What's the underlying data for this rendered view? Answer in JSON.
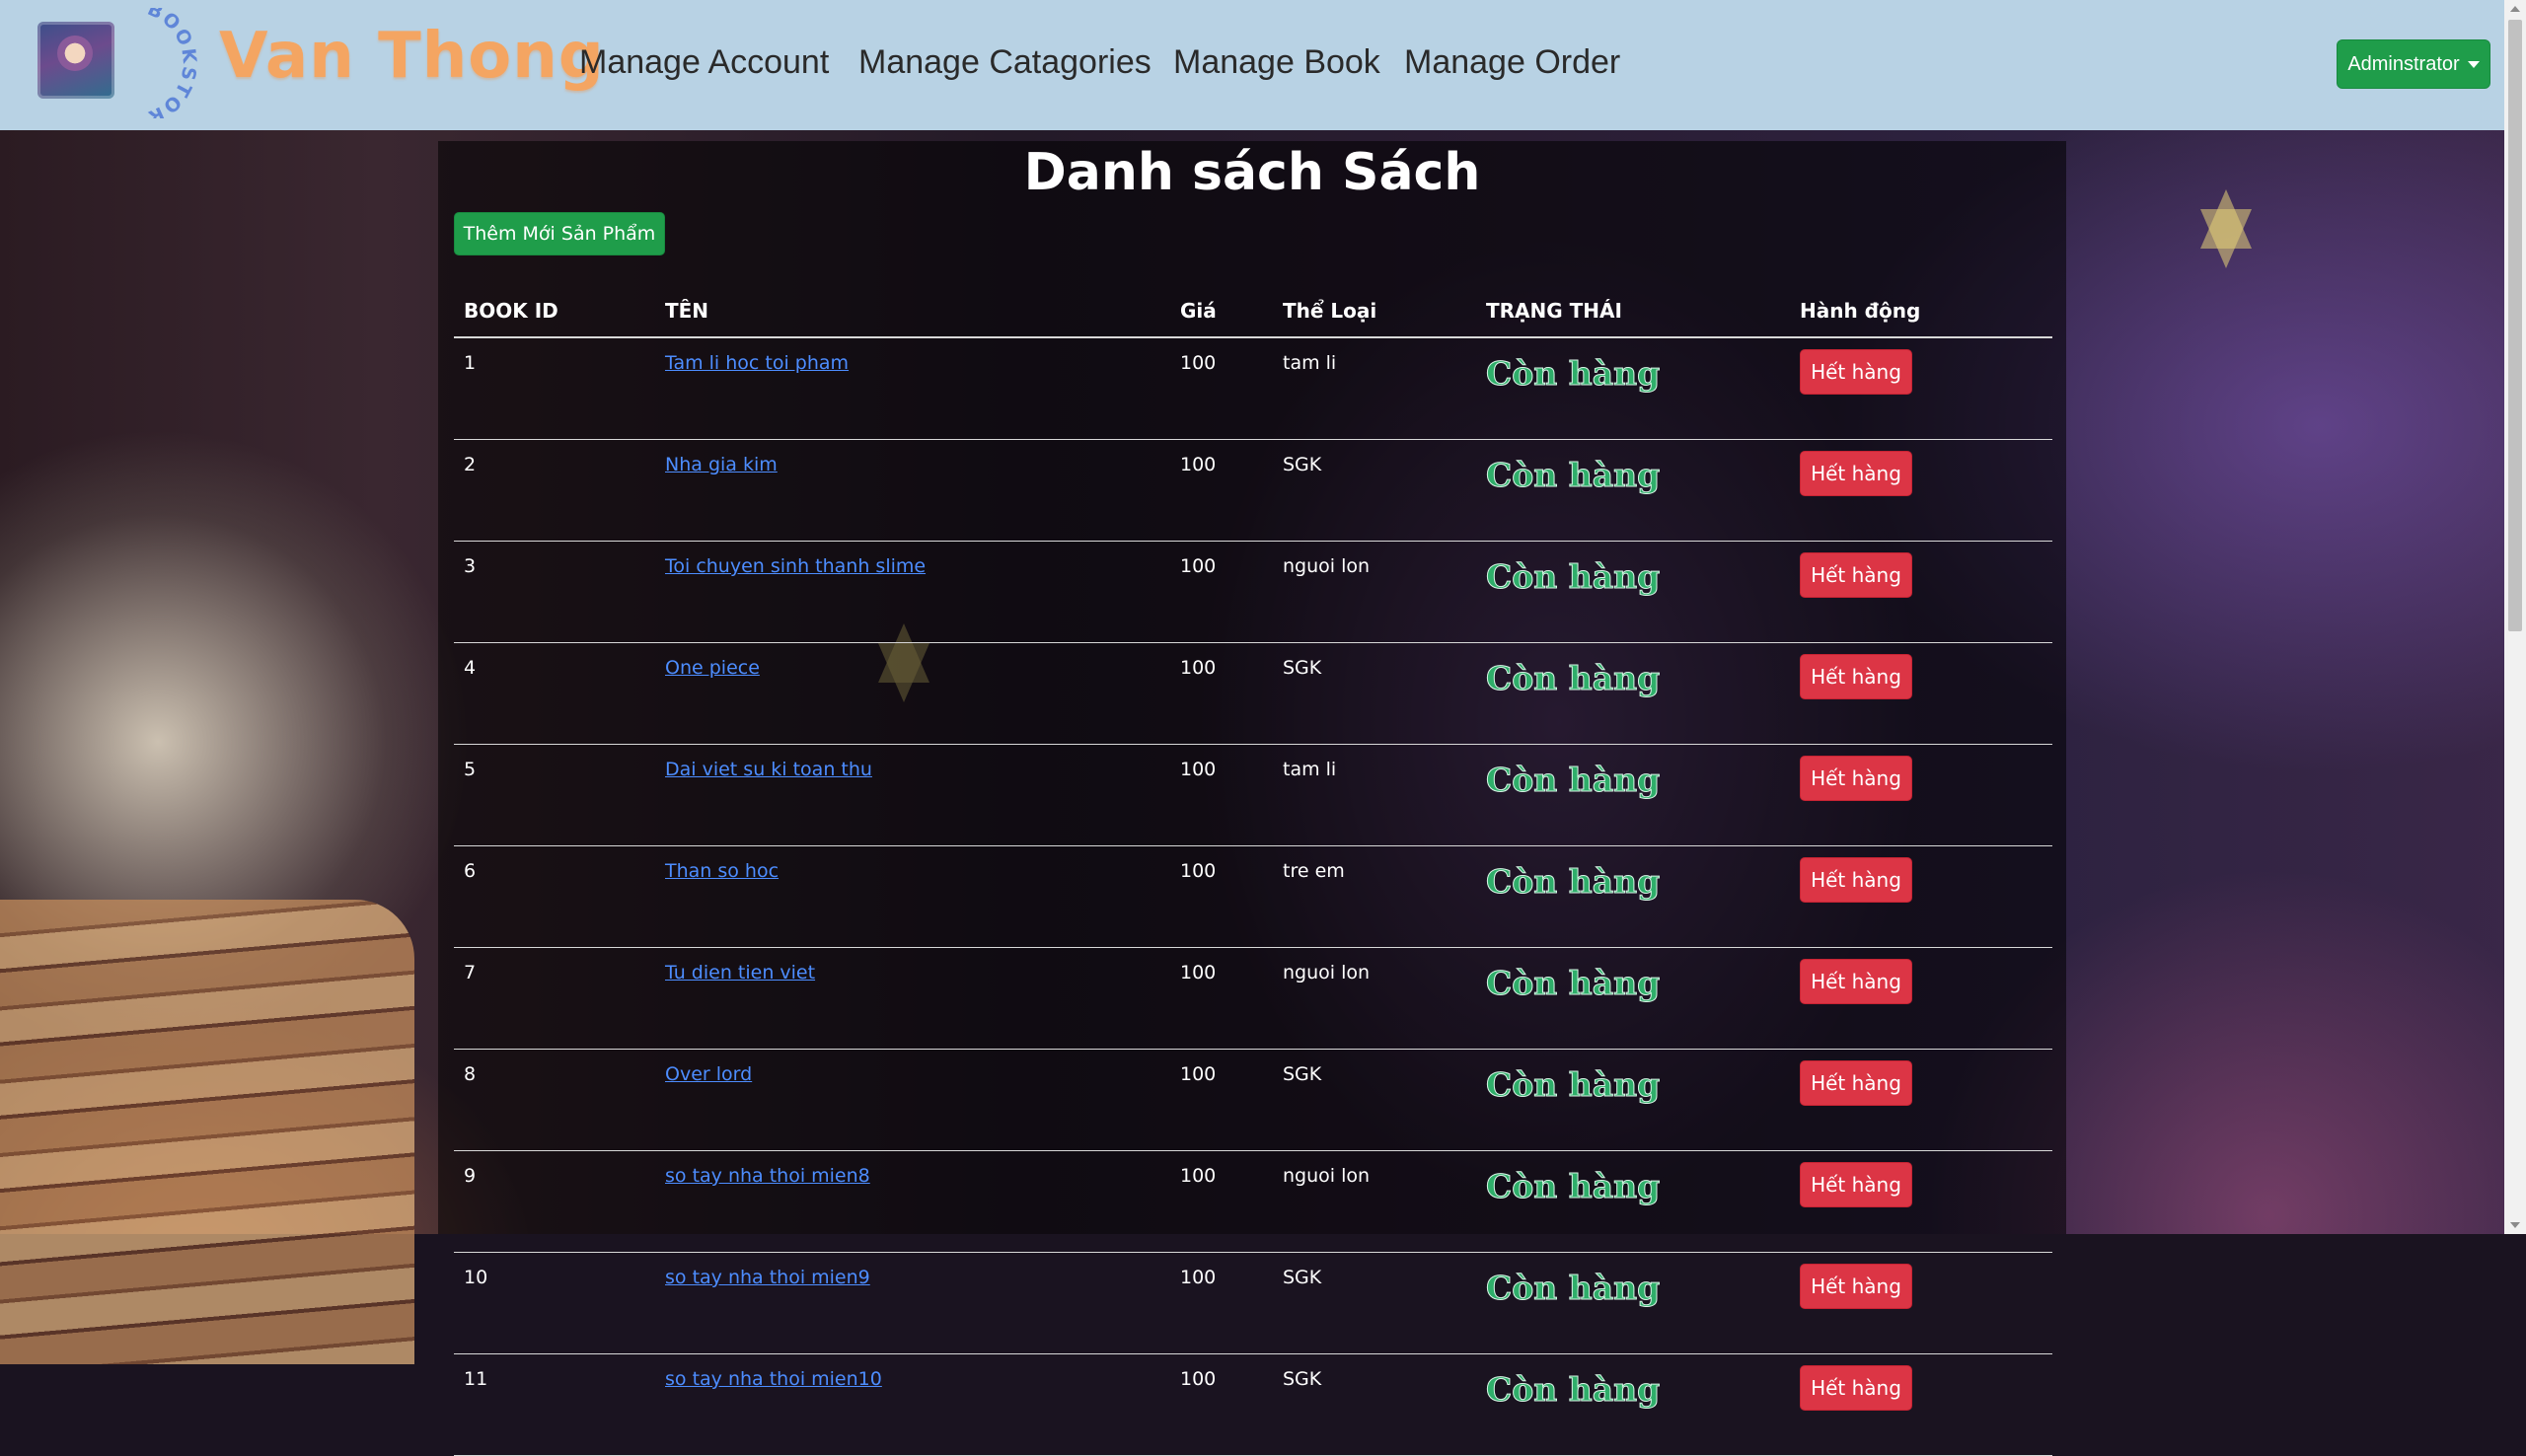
{
  "navbar": {
    "logo_icon": "bookstore-logo-icon",
    "logo_arc_text": "BOOKSTORE",
    "brand": "Van Thong",
    "links": [
      "Manage Account",
      "Manage Catagories",
      "Manage Book",
      "Manage Order"
    ],
    "admin_label": "Adminstrator"
  },
  "main": {
    "title": "Danh sách Sách",
    "add_button": "Thêm Mới Sản Phẩm",
    "table": {
      "headers": [
        "BOOK ID",
        "TÊN",
        "Giá",
        "Thể Loại",
        "TRẠNG THÁI",
        "Hành động"
      ],
      "rows": [
        {
          "id": "1",
          "name": "Tam li hoc toi pham",
          "price": "100",
          "category": "tam li",
          "status": "Còn hàng",
          "action": "Hết hàng"
        },
        {
          "id": "2",
          "name": "Nha gia kim",
          "price": "100",
          "category": "SGK",
          "status": "Còn hàng",
          "action": "Hết hàng"
        },
        {
          "id": "3",
          "name": "Toi chuyen sinh thanh slime",
          "price": "100",
          "category": "nguoi lon",
          "status": "Còn hàng",
          "action": "Hết hàng"
        },
        {
          "id": "4",
          "name": "One piece",
          "price": "100",
          "category": "SGK",
          "status": "Còn hàng",
          "action": "Hết hàng"
        },
        {
          "id": "5",
          "name": "Dai viet su ki toan thu",
          "price": "100",
          "category": "tam li",
          "status": "Còn hàng",
          "action": "Hết hàng"
        },
        {
          "id": "6",
          "name": "Than so hoc",
          "price": "100",
          "category": "tre em",
          "status": "Còn hàng",
          "action": "Hết hàng"
        },
        {
          "id": "7",
          "name": "Tu dien tien viet",
          "price": "100",
          "category": "nguoi lon",
          "status": "Còn hàng",
          "action": "Hết hàng"
        },
        {
          "id": "8",
          "name": "Over lord",
          "price": "100",
          "category": "SGK",
          "status": "Còn hàng",
          "action": "Hết hàng"
        },
        {
          "id": "9",
          "name": "so tay nha thoi mien8",
          "price": "100",
          "category": "nguoi lon",
          "status": "Còn hàng",
          "action": "Hết hàng"
        },
        {
          "id": "10",
          "name": "so tay nha thoi mien9",
          "price": "100",
          "category": "SGK",
          "status": "Còn hàng",
          "action": "Hết hàng"
        },
        {
          "id": "11",
          "name": "so tay nha thoi mien10",
          "price": "100",
          "category": "SGK",
          "status": "Còn hàng",
          "action": "Hết hàng"
        }
      ]
    }
  },
  "colors": {
    "navbar_bg": "#b8d2e4",
    "brand": "#f4a562",
    "success": "#1f9d4a",
    "danger": "#dc3545",
    "link": "#4d8dff",
    "status_text": "#2fae6a"
  }
}
